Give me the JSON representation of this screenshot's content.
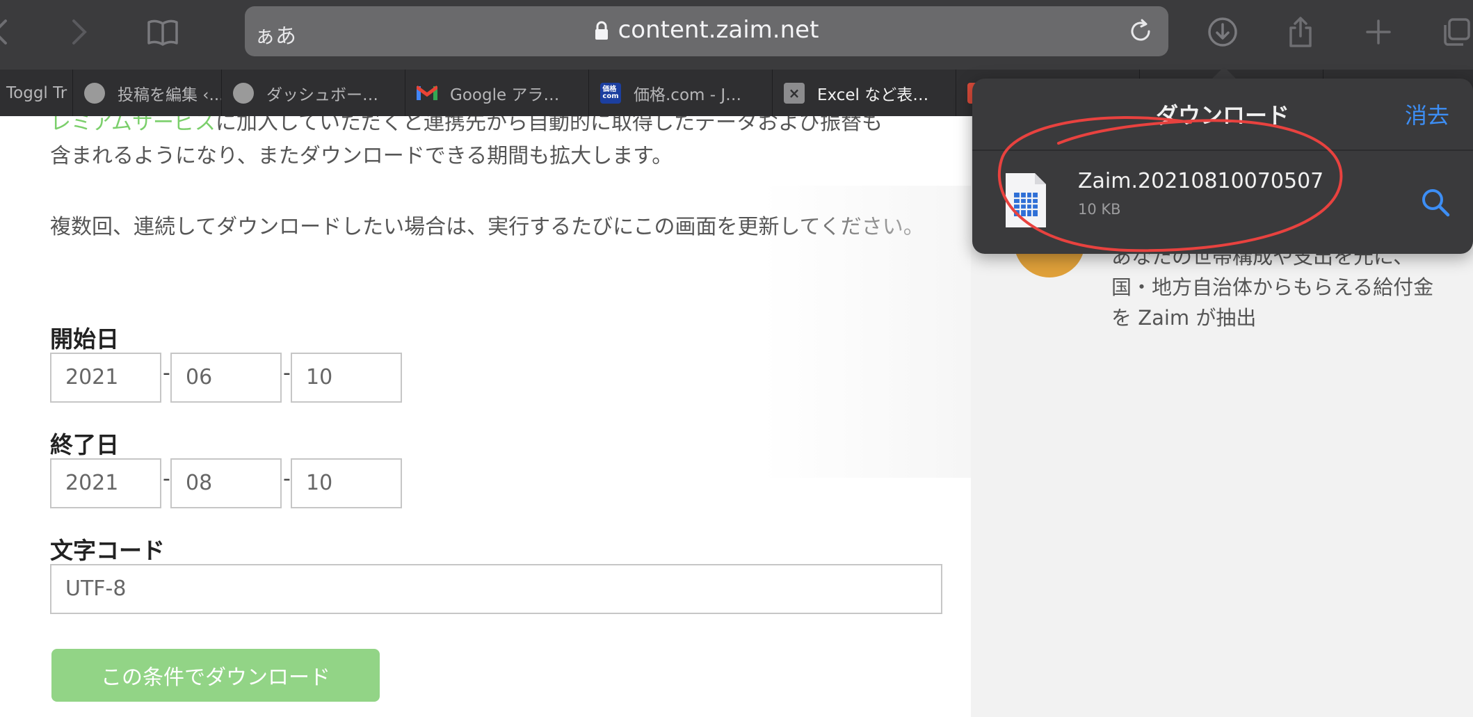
{
  "browser": {
    "reader_label": "ぁあ",
    "url": "content.zaim.net",
    "tabs": [
      {
        "title": "Toggl Tr",
        "icon": "none"
      },
      {
        "title": "投稿を編集 ‹...",
        "icon": "wordpress-icon"
      },
      {
        "title": "ダッシュボー…",
        "icon": "wordpress-icon"
      },
      {
        "title": "Google アラ…",
        "icon": "gmail-icon"
      },
      {
        "title": "価格.com - J…",
        "icon": "kakaku-icon"
      },
      {
        "title": "Excel など表…",
        "icon": "close-icon"
      },
      {
        "title": "",
        "icon": "tab-icon"
      }
    ],
    "active_tab_index": 5
  },
  "page": {
    "intro_link": "レミアムサービス",
    "intro_line1_rest": "に加入していただくと連携先から自動的に取得したデータおよび振替も",
    "intro_line2": "含まれるようになり、またダウンロードできる期間も拡大します。",
    "repeat_note": "複数回、連続してダウンロードしたい場合は、実行するたびにこの画面を更新してください。",
    "start_label": "開始日",
    "start": {
      "year": "2021",
      "month": "06",
      "day": "10"
    },
    "end_label": "終了日",
    "end": {
      "year": "2021",
      "month": "08",
      "day": "10"
    },
    "date_separator": "-",
    "encoding_label": "文字コード",
    "encoding_value": "UTF-8",
    "download_button": "この条件でダウンロード"
  },
  "side": {
    "line1": "あなたの世帯構成や支出を元に、",
    "line2": "国・地方自治体からもらえる給付金",
    "line3": "を Zaim が抽出"
  },
  "downloads": {
    "title": "ダウンロード",
    "clear_label": "消去",
    "file_name": "Zaim.20210810070507",
    "file_size": "10 KB"
  },
  "colors": {
    "accent_blue": "#3d8ef5",
    "button_green": "#92d486",
    "link_green": "#7bcf6b",
    "annotation_red": "#e8423f"
  }
}
